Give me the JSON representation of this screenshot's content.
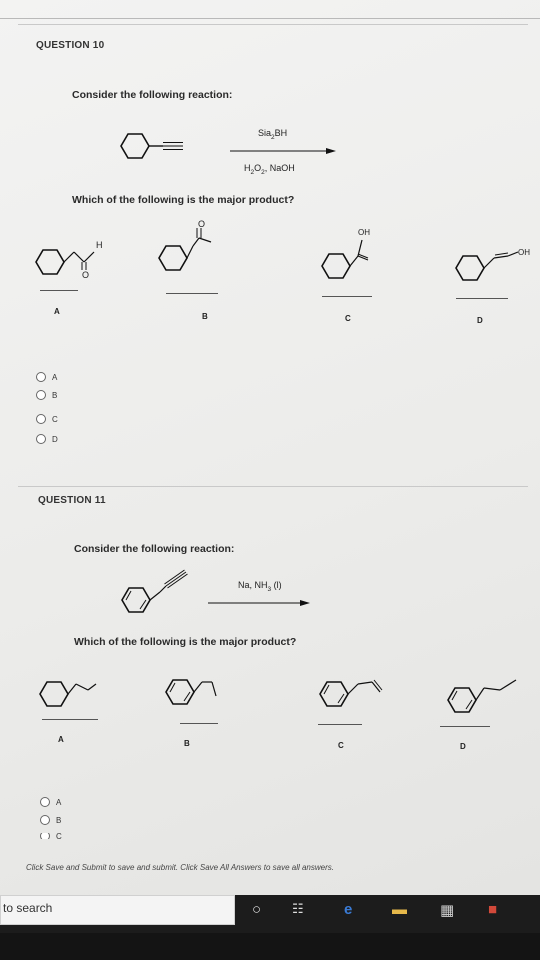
{
  "q10": {
    "title": "QUESTION 10",
    "stem": "Consider the following reaction:",
    "reagent_top": "Sia",
    "reagent_top_sub": "2",
    "reagent_top_rest": "BH",
    "reagent_bottom_1": "H",
    "reagent_bottom_sub1": "2",
    "reagent_bottom_2": "O",
    "reagent_bottom_sub2": "2",
    "reagent_bottom_3": ", NaOH",
    "question": "Which of the following is the major product?",
    "labels": [
      "A",
      "B",
      "C",
      "D"
    ],
    "atom_H": "H",
    "atom_O": "O",
    "atom_O_b": "O",
    "atom_OH_c": "OH",
    "atom_OH_d": "OH",
    "options": [
      "A",
      "B",
      "C",
      "D"
    ]
  },
  "q11": {
    "title": "QUESTION 11",
    "stem": "Consider the following reaction:",
    "reagent_1": "Na, NH",
    "reagent_sub": "3",
    "reagent_2": " (l)",
    "question": "Which of the following is the major product?",
    "labels": [
      "A",
      "B",
      "C",
      "D"
    ],
    "options": [
      "A",
      "B",
      "C"
    ]
  },
  "footer": "Click Save and Submit to save and submit. Click Save All Answers to save all answers.",
  "taskbar": {
    "search_text": "to search"
  }
}
